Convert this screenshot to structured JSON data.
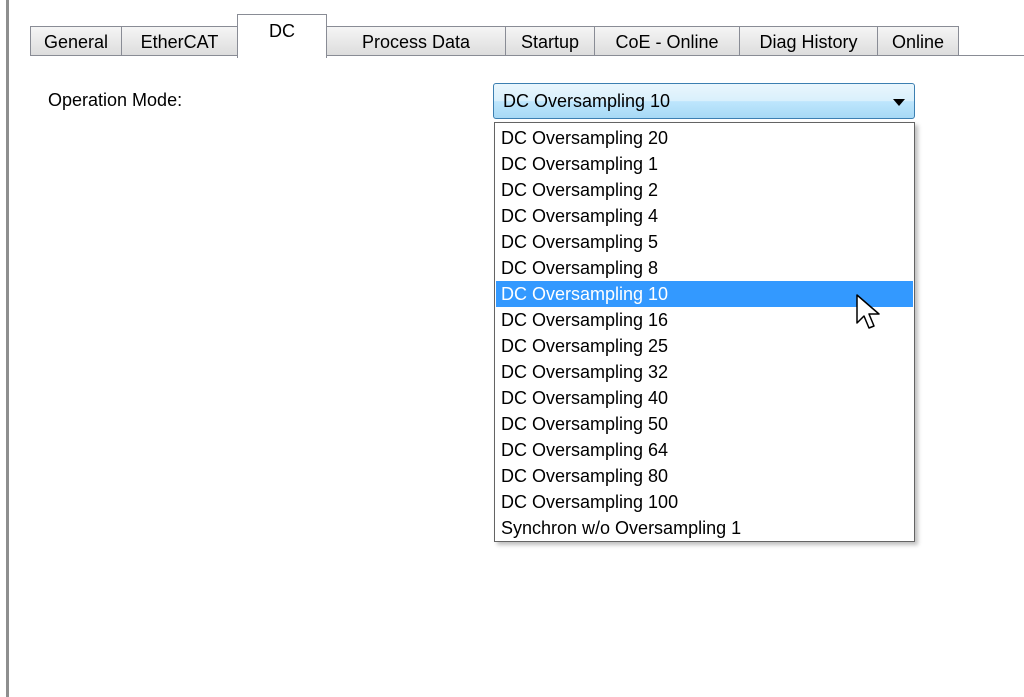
{
  "tabs": [
    {
      "label": "General"
    },
    {
      "label": "EtherCAT"
    },
    {
      "label": "DC"
    },
    {
      "label": "Process Data"
    },
    {
      "label": "Startup"
    },
    {
      "label": "CoE - Online"
    },
    {
      "label": "Diag History"
    },
    {
      "label": "Online"
    }
  ],
  "active_tab": "DC",
  "operation_mode": {
    "label": "Operation Mode:",
    "selected": "DC Oversampling 10",
    "options": [
      "DC Oversampling 20",
      "DC Oversampling 1",
      "DC Oversampling 2",
      "DC Oversampling 4",
      "DC Oversampling 5",
      "DC Oversampling 8",
      "DC Oversampling 10",
      "DC Oversampling 16",
      "DC Oversampling 25",
      "DC Oversampling 32",
      "DC Oversampling 40",
      "DC Oversampling 50",
      "DC Oversampling 64",
      "DC Oversampling 80",
      "DC Oversampling 100",
      "Synchron w/o Oversampling 1"
    ]
  },
  "colors": {
    "highlight": "#3399ff",
    "combo_border": "#3c7fb1",
    "tab_border": "#898c95"
  },
  "icons": {
    "cursor": "mouse-pointer-icon",
    "dropdown_arrow": "chevron-down-icon"
  }
}
